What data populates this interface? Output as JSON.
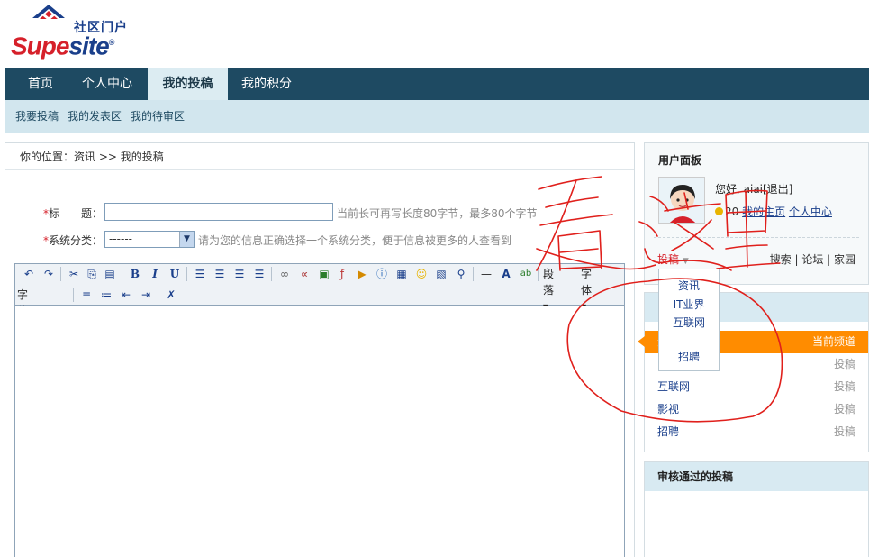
{
  "logo": {
    "cn": "社区门户",
    "en_part1": "Supe",
    "en_part2": "site",
    "reg": "®"
  },
  "mainnav": [
    {
      "label": "首页",
      "active": false
    },
    {
      "label": "个人中心",
      "active": false
    },
    {
      "label": "我的投稿",
      "active": true
    },
    {
      "label": "我的积分",
      "active": false
    }
  ],
  "subnav": [
    "我要投稿",
    "我的发表区",
    "我的待审区"
  ],
  "breadcrumb": "你的位置：资讯 >> 我的投稿",
  "form": {
    "title_label": "标　　题：",
    "title_hint": "当前长可再写长度80字节，最多80个字节",
    "title_value": "",
    "category_label": "系统分类：",
    "category_value": "------",
    "category_hint": "请为您的信息正确选择一个系统分类，便于信息被更多的人查看到",
    "required_mark": "*"
  },
  "toolbar": {
    "paragraph": "段落",
    "font": "字体",
    "font_size": "字体大小",
    "bold": "B",
    "italic": "I",
    "underline": "U"
  },
  "userpanel": {
    "title": "用户面板",
    "greeting": "您好, aiai[退出]",
    "coins": "20",
    "my_home": "我的主页",
    "personal_center": "个人中心",
    "post": "投稿",
    "right_links": "搜索 | 论坛 | 家园"
  },
  "dropdown": [
    "资讯",
    "IT业界",
    "互联网",
    "招聘"
  ],
  "channels": [
    {
      "name": "资讯",
      "action": "当前频道",
      "current": true
    },
    {
      "name": "IT业界",
      "action": "投稿",
      "current": false
    },
    {
      "name": "互联网",
      "action": "投稿",
      "current": false
    },
    {
      "name": "影视",
      "action": "投稿",
      "current": false
    },
    {
      "name": "招聘",
      "action": "投稿",
      "current": false
    }
  ],
  "approved_title": "审核通过的投稿",
  "annotation": {
    "handwritten_text": "看这里",
    "color": "#e0201c"
  },
  "colors": {
    "nav_bg": "#1e4a62",
    "subnav_bg": "#d2e6ee",
    "current_channel": "#ff8c00",
    "brand_red": "#d6202a",
    "brand_blue": "#1a3f8b"
  }
}
